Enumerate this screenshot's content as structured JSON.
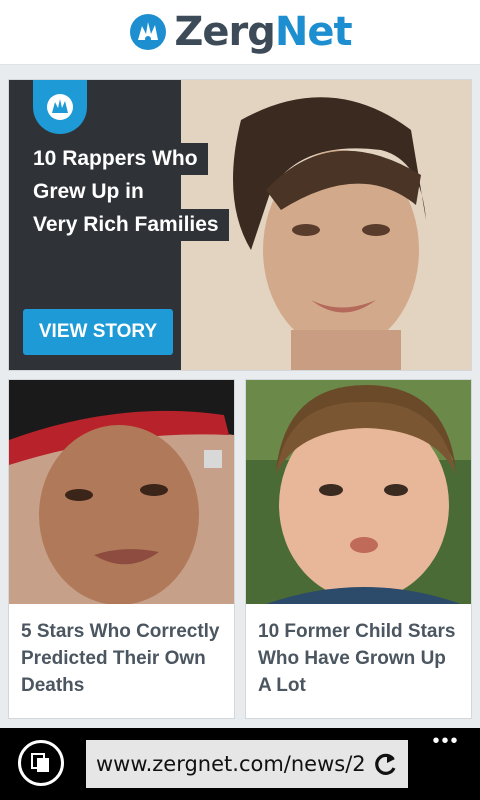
{
  "header": {
    "logo_icon": "zergnet-splash-icon",
    "logo_zerg": "Zerg",
    "logo_net": "Net"
  },
  "hero": {
    "badge_icon": "zergnet-splash-icon",
    "title_lines": [
      "10 Rappers Who",
      "Grew Up in",
      "Very Rich Families"
    ],
    "cta_label": "VIEW STORY"
  },
  "cards": [
    {
      "title": "5 Stars Who Correctly Predicted Their Own Deaths"
    },
    {
      "title": "10 Former Child Stars Who Have Grown Up A Lot"
    }
  ],
  "browser": {
    "tabs_icon": "tabs-icon",
    "url": "www.zergnet.com/news/2",
    "refresh_icon": "refresh-icon",
    "more_icon": "more-dots-icon",
    "more_label": "•••"
  },
  "colors": {
    "brand_blue": "#1e9ad6",
    "brand_dark": "#3d4a57",
    "hero_bg": "#2f3337"
  }
}
